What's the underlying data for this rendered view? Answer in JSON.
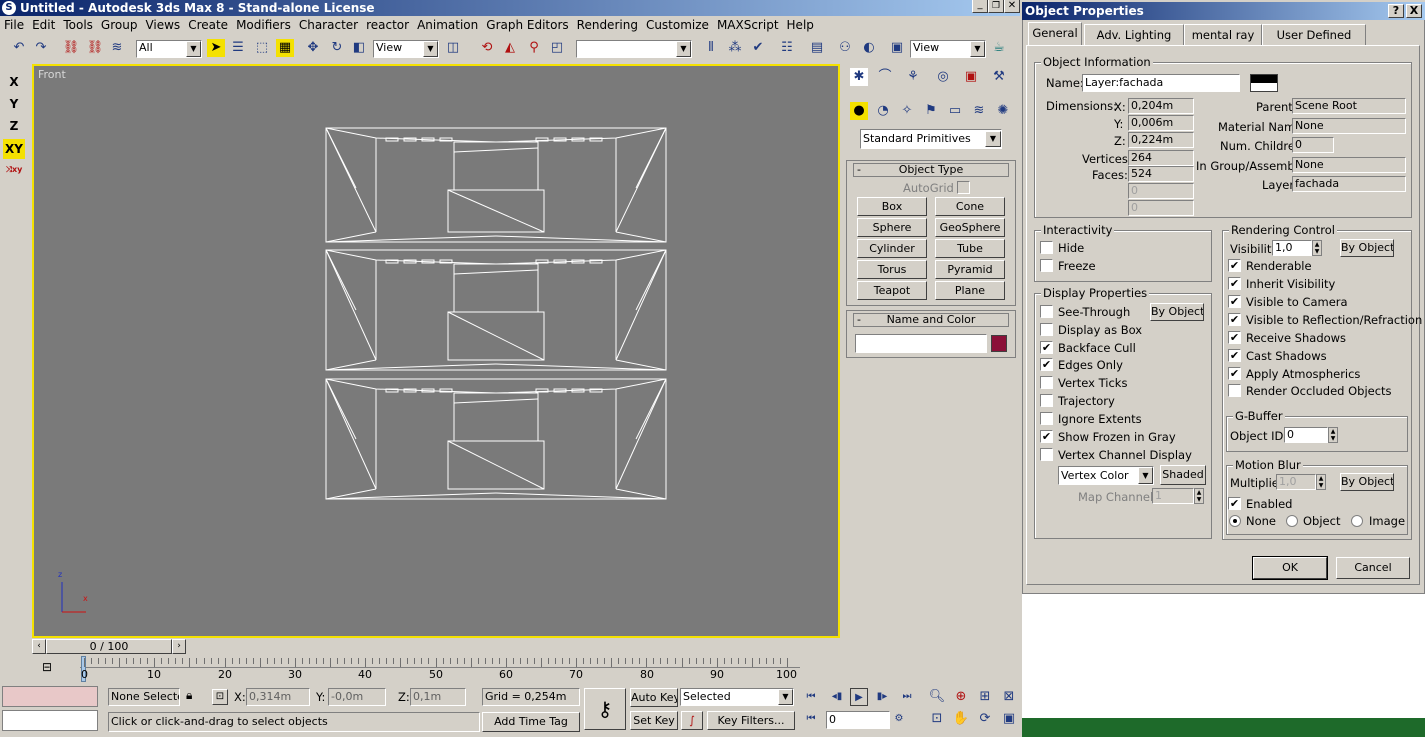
{
  "app": {
    "title": "Untitled - Autodesk 3ds Max 8  - Stand-alone License",
    "icon": "3dsmax-logo-icon"
  },
  "window_controls": [
    "minimize",
    "restore",
    "close"
  ],
  "menu": [
    "File",
    "Edit",
    "Tools",
    "Group",
    "Views",
    "Create",
    "Modifiers",
    "Character",
    "reactor",
    "Animation",
    "Graph Editors",
    "Rendering",
    "Customize",
    "MAXScript",
    "Help"
  ],
  "toolbar": {
    "selection_filter": "All",
    "ref_coord": "View",
    "named_sel": "",
    "view_dropdown": "View"
  },
  "axis": [
    "X",
    "Y",
    "Z",
    "XY"
  ],
  "viewport": {
    "label": "Front",
    "axis_z": "z",
    "axis_x": "x"
  },
  "command_panel": {
    "category": "Standard Primitives",
    "object_type_title": "Object Type",
    "autogrid": "AutoGrid",
    "buttons": [
      "Box",
      "Cone",
      "Sphere",
      "GeoSphere",
      "Cylinder",
      "Tube",
      "Torus",
      "Pyramid",
      "Teapot",
      "Plane"
    ],
    "name_color_title": "Name and Color",
    "name_value": "",
    "object_color": "#8b1038"
  },
  "timeline": {
    "slider": "0 / 100",
    "ticks": [
      "0",
      "10",
      "20",
      "30",
      "40",
      "50",
      "60",
      "70",
      "80",
      "90",
      "100"
    ]
  },
  "status": {
    "selection": "None Selecte",
    "x_label": "X:",
    "x": "0,314m",
    "y_label": "Y:",
    "y": "-0,0m",
    "z_label": "Z:",
    "z": "0,1m",
    "grid": "Grid = 0,254m",
    "prompt": "Click or click-and-drag to select objects",
    "add_time_tag": "Add Time Tag",
    "auto_key": "Auto Key",
    "set_key": "Set Key",
    "key_mode": "Selected",
    "key_filters": "Key Filters...",
    "frame": "0"
  },
  "dialog": {
    "title": "Object Properties",
    "help": "?",
    "close": "X",
    "tabs": [
      "General",
      "Adv. Lighting",
      "mental ray",
      "User Defined"
    ],
    "info": {
      "title": "Object Information",
      "name_label": "Name:",
      "name": "Layer:fachada",
      "swatch_color": "#000000",
      "dimensions_label": "Dimensions:",
      "x_label": "X:",
      "x": "0,204m",
      "y_label": "Y:",
      "y": "0,006m",
      "z_label": "Z:",
      "z": "0,224m",
      "vertices_label": "Vertices:",
      "vertices": "264",
      "faces_label": "Faces:",
      "faces": "524",
      "blank1": "0",
      "blank2": "0",
      "parent_label": "Parent:",
      "parent": "Scene Root",
      "material_label": "Material Name:",
      "material": "None",
      "children_label": "Num. Children:",
      "children": "0",
      "group_label": "In Group/Assembly:",
      "group": "None",
      "layer_label": "Layer:",
      "layer": "fachada"
    },
    "interactivity": {
      "title": "Interactivity",
      "hide": "Hide",
      "freeze": "Freeze"
    },
    "display": {
      "title": "Display Properties",
      "by_object": "By Object",
      "items": [
        {
          "label": "See-Through",
          "checked": false
        },
        {
          "label": "Display as Box",
          "checked": false
        },
        {
          "label": "Backface Cull",
          "checked": true
        },
        {
          "label": "Edges Only",
          "checked": true
        },
        {
          "label": "Vertex Ticks",
          "checked": false
        },
        {
          "label": "Trajectory",
          "checked": false
        },
        {
          "label": "Ignore Extents",
          "checked": false
        },
        {
          "label": "Show Frozen in Gray",
          "checked": true
        },
        {
          "label": "Vertex Channel Display",
          "checked": false
        }
      ],
      "vertex_color": "Vertex Color",
      "shaded": "Shaded",
      "map_channel_label": "Map Channel:",
      "map_channel": "1"
    },
    "rendering": {
      "title": "Rendering Control",
      "visibility_label": "Visibility:",
      "visibility": "1,0",
      "by_object": "By Object",
      "items": [
        {
          "label": "Renderable",
          "checked": true
        },
        {
          "label": "Inherit Visibility",
          "checked": true
        },
        {
          "label": "Visible to Camera",
          "checked": true
        },
        {
          "label": "Visible to Reflection/Refraction",
          "checked": true
        },
        {
          "label": "Receive Shadows",
          "checked": true
        },
        {
          "label": "Cast Shadows",
          "checked": true
        },
        {
          "label": "Apply Atmospherics",
          "checked": true
        },
        {
          "label": "Render Occluded Objects",
          "checked": false
        }
      ]
    },
    "gbuffer": {
      "title": "G-Buffer",
      "object_id_label": "Object ID:",
      "object_id": "0"
    },
    "motion_blur": {
      "title": "Motion Blur",
      "multiplier_label": "Multiplier:",
      "multiplier": "1,0",
      "by_object": "By Object",
      "enabled": "Enabled",
      "none": "None",
      "object": "Object",
      "image": "Image"
    },
    "ok": "OK",
    "cancel": "Cancel"
  }
}
